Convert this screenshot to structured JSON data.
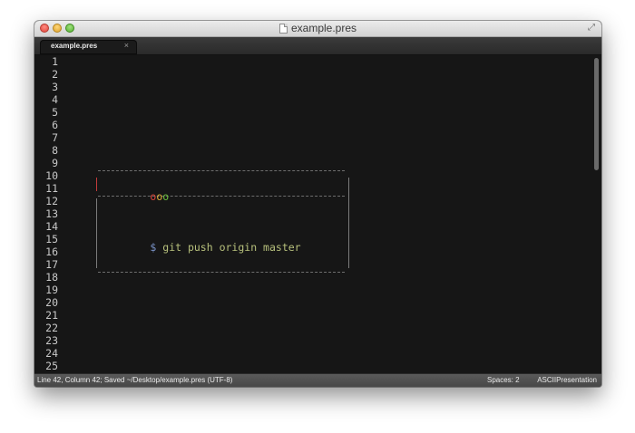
{
  "window": {
    "title": "example.pres"
  },
  "tabs": [
    {
      "label": "example.pres",
      "close": "×"
    }
  ],
  "editor": {
    "line_numbers": [
      "1",
      "2",
      "3",
      "4",
      "5",
      "6",
      "7",
      "8",
      "9",
      "10",
      "11",
      "12",
      "13",
      "14",
      "15",
      "16",
      "17",
      "18",
      "19",
      "20",
      "21",
      "22",
      "23",
      "24",
      "25"
    ],
    "dots": [
      "o",
      "o",
      "o"
    ],
    "dot_colors": [
      "#e0463c",
      "#e0b23a",
      "#6cc13c"
    ],
    "prompt": "$",
    "command": "git push origin master"
  },
  "status": {
    "position": "Line 42, Column 42; Saved ~/Desktop/example.pres (UTF-8)",
    "spaces": "Spaces: 2",
    "syntax": "ASCIIPresentation"
  }
}
